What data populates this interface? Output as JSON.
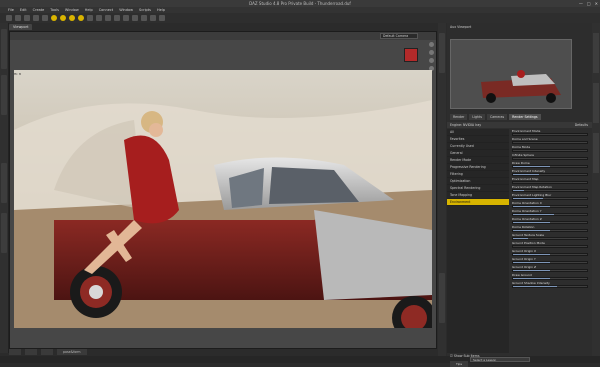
{
  "window": {
    "title": "DAZ Studio 4.8 Pro Private Build - Thunderroad.duf"
  },
  "menu": [
    "File",
    "Edit",
    "Create",
    "Tools",
    "Window",
    "Help",
    "Connect",
    "Window",
    "Scripts",
    "Help"
  ],
  "viewport": {
    "tabs": [
      "Viewport"
    ],
    "camera": "Default Camera",
    "corner_label": "Hi: 8"
  },
  "bottom_tabs": [
    "",
    "",
    "",
    "pose&form"
  ],
  "status": {
    "select": "Select a Lesson"
  },
  "preview_tab": "Aux Viewport",
  "panel": {
    "tabs": [
      "Render",
      "Lights",
      "Cameras",
      "Render Settings"
    ],
    "header_left": "Engine: NVIDIA Iray",
    "header_right": "Defaults",
    "categories": [
      "All",
      "Favorites",
      "Currently Used",
      "General",
      "Render Mode",
      "Progressive Rendering",
      "Filtering",
      "Optimization",
      "Spectral Rendering",
      "Tone Mapping",
      "Environment"
    ],
    "selected_category": "Environment",
    "properties": [
      {
        "label": "Environment Mode",
        "fill": 0.0
      },
      {
        "label": "Dome and Scene",
        "fill": 0.0
      },
      {
        "label": "Dome Mode",
        "fill": 0.0
      },
      {
        "label": "Infinite Sphere",
        "fill": 0.0
      },
      {
        "label": "Draw Dome",
        "fill": 0.5
      },
      {
        "label": "Environment Intensity",
        "fill": 0.35
      },
      {
        "label": "Environment Map",
        "fill": 0.0
      },
      {
        "label": "Environment Map Rotation",
        "fill": 0.15
      },
      {
        "label": "Environment Lighting Blur",
        "fill": 0.4
      },
      {
        "label": "Dome Orientation X",
        "fill": 0.5
      },
      {
        "label": "Dome Orientation Y",
        "fill": 0.55
      },
      {
        "label": "Dome Orientation Z",
        "fill": 0.5
      },
      {
        "label": "Dome Rotation",
        "fill": 0.5
      },
      {
        "label": "Ground Texture Scale",
        "fill": 0.2
      },
      {
        "label": "Ground Position Mode",
        "fill": 0.0
      },
      {
        "label": "Ground Origin X",
        "fill": 0.5
      },
      {
        "label": "Ground Origin Y",
        "fill": 0.5
      },
      {
        "label": "Ground Origin Z",
        "fill": 0.5
      },
      {
        "label": "Draw Ground",
        "fill": 0.5
      },
      {
        "label": "Ground Shadow Intensity",
        "fill": 0.6
      }
    ],
    "show_sub": "Show Sub Items",
    "tips": "Tips"
  }
}
